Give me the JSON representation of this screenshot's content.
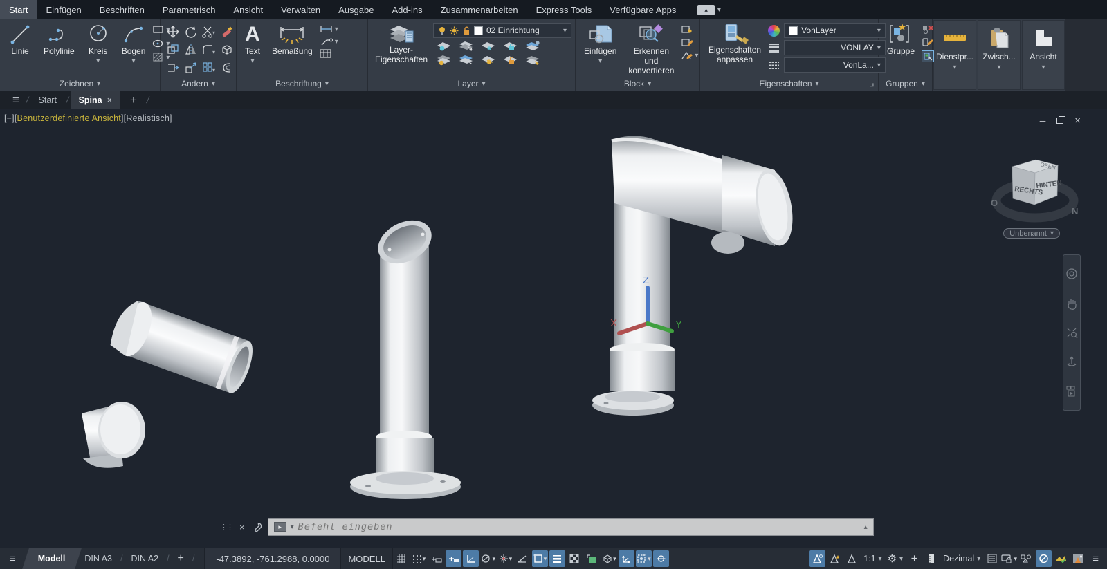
{
  "icons": {
    "caret-down": "▾",
    "caret-up": "▴",
    "plus": "+",
    "close": "×",
    "hamburger": "≡",
    "slash": "/",
    "minimize": "─",
    "gear": "⚙",
    "grip": "⋮⋮",
    "prompt": "▸",
    "grid": "#",
    "scale_x": "1:1"
  },
  "menubar": {
    "tabs": [
      "Start",
      "Einfügen",
      "Beschriften",
      "Parametrisch",
      "Ansicht",
      "Verwalten",
      "Ausgabe",
      "Add-ins",
      "Zusammenarbeiten",
      "Express Tools",
      "Verfügbare Apps"
    ]
  },
  "ribbon": {
    "zeichnen": {
      "label": "Zeichnen",
      "linie": "Linie",
      "polylinie": "Polylinie",
      "kreis": "Kreis",
      "bogen": "Bogen"
    },
    "aendern": {
      "label": "Ändern"
    },
    "beschriftung": {
      "label": "Beschriftung",
      "text": "Text",
      "bemassung": "Bemaßung"
    },
    "layer": {
      "label": "Layer",
      "eigenschaften": "Layer-\nEigenschaften",
      "combo": "02 Einrichtung"
    },
    "block": {
      "label": "Block",
      "einfuegen": "Einfügen",
      "erkennen": "Erkennen und\nkonvertieren"
    },
    "eigenschaften": {
      "label": "Eigenschaften",
      "anpassen": "Eigenschaften\nanpassen",
      "farbe": "VonLayer",
      "linienstaerke": "VONLAY",
      "linientyp": "VonLa..."
    },
    "gruppen": {
      "label": "Gruppen",
      "gruppe": "Gruppe"
    },
    "dienst": {
      "label": "Dienstpr..."
    },
    "zwischen": {
      "label": "Zwisch..."
    },
    "ansicht": {
      "label": "Ansicht"
    }
  },
  "filetabs": {
    "start": "Start",
    "active": "Spina"
  },
  "viewport": {
    "corner": "[−]",
    "bracket_open": "[",
    "view": "Benutzerdefinierte Ansicht",
    "bracket_close": "]",
    "style": "[Realistisch]"
  },
  "viewcube": {
    "left": "RECHTS",
    "right": "HINTEN",
    "top": "OBEN",
    "west": "O",
    "north": "N",
    "selector": "Unbenannt"
  },
  "commandline": {
    "placeholder": "Befehl eingeben"
  },
  "statusbar": {
    "model": "Modell",
    "din3": "DIN A3",
    "din2": "DIN A2",
    "coords": "-47.3892, -761.2988, 0.0000",
    "space": "MODELL",
    "scale": "1:1",
    "units": "Dezimal"
  }
}
